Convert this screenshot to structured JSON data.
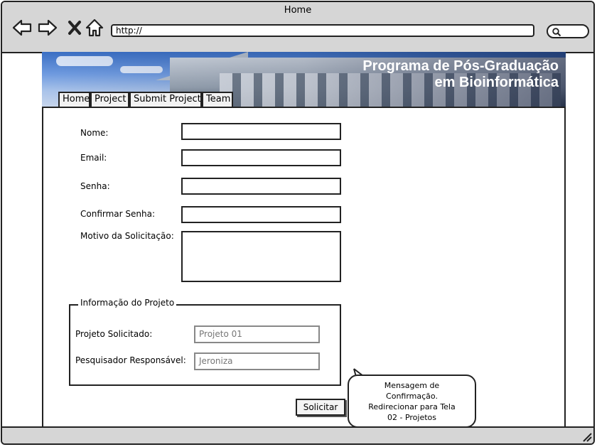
{
  "window": {
    "title": "Home"
  },
  "browser": {
    "url": "http://",
    "back_icon": "back-arrow-icon",
    "forward_icon": "forward-arrow-icon",
    "stop_icon": "close-icon",
    "home_icon": "home-icon",
    "search_icon": "search-icon"
  },
  "banner": {
    "title_line1": "Programa de Pós-Graduação",
    "title_line2": "em Bioinformática"
  },
  "tabs": [
    {
      "label": "Home"
    },
    {
      "label": "Project"
    },
    {
      "label": "Submit Project"
    },
    {
      "label": "Team"
    }
  ],
  "form": {
    "nome_label": "Nome:",
    "email_label": "Email:",
    "senha_label": "Senha:",
    "confirmar_label": "Confirmar Senha:",
    "motivo_label": "Motivo da Solicitação:",
    "nome_value": "",
    "email_value": "",
    "senha_value": "",
    "confirmar_value": "",
    "motivo_value": ""
  },
  "project_info": {
    "legend": "Informação do Projeto",
    "projeto_label": "Projeto Solicitado:",
    "projeto_value": "Projeto 01",
    "pesquisador_label": "Pesquisador Responsável:",
    "pesquisador_value": "Jeroniza"
  },
  "submit": {
    "label": "Solicitar"
  },
  "note": {
    "line1": "Mensagem de",
    "line2": "Confirmação.",
    "line3": "Redirecionar para Tela",
    "line4": "02 - Projetos"
  }
}
